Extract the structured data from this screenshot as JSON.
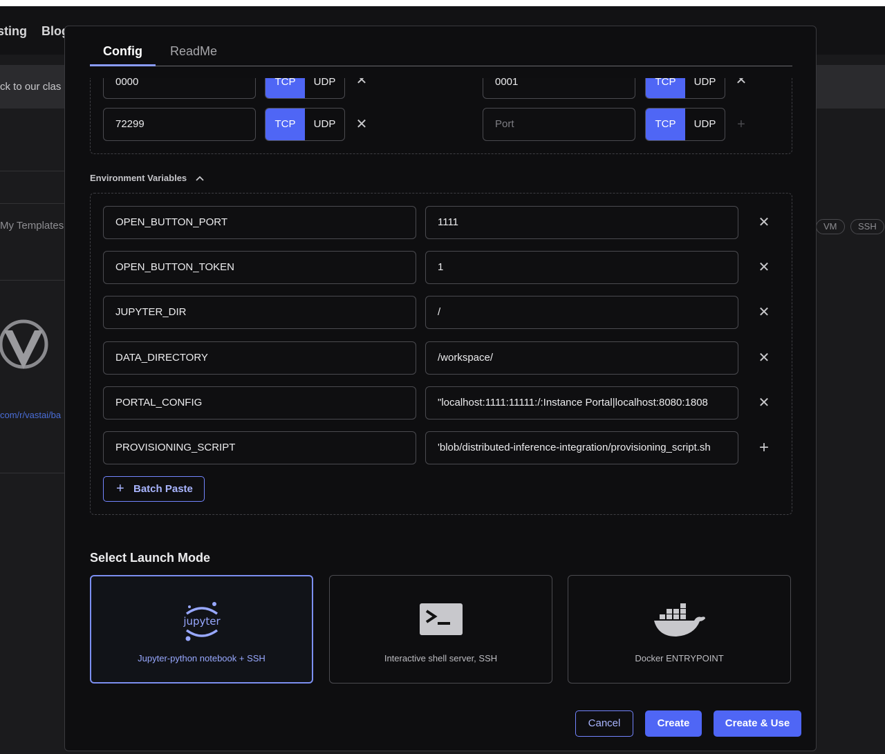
{
  "background": {
    "nav": [
      "sting",
      "Blog"
    ],
    "banner": "ck to our clas",
    "my_templates": "My Templates",
    "link": "com/r/vastai/ba",
    "chips": [
      "VM",
      "SSH"
    ]
  },
  "modal": {
    "tabs": [
      {
        "label": "Config",
        "active": true
      },
      {
        "label": "ReadMe",
        "active": false
      }
    ],
    "ports": {
      "rows": [
        {
          "left_value": "0000",
          "left_proto": [
            "TCP",
            "UDP"
          ],
          "right_value": "0001",
          "right_proto": [
            "TCP",
            "UDP"
          ]
        },
        {
          "left_value": "72299",
          "left_proto": [
            "TCP",
            "UDP"
          ],
          "right_placeholder": "Port",
          "right_proto": [
            "TCP",
            "UDP"
          ]
        }
      ]
    },
    "env": {
      "heading": "Environment Variables",
      "rows": [
        {
          "key": "OPEN_BUTTON_PORT",
          "value": "1111",
          "action": "✕"
        },
        {
          "key": "OPEN_BUTTON_TOKEN",
          "value": "1",
          "action": "✕"
        },
        {
          "key": "JUPYTER_DIR",
          "value": "/",
          "action": "✕"
        },
        {
          "key": "DATA_DIRECTORY",
          "value": "/workspace/",
          "action": "✕"
        },
        {
          "key": "PORTAL_CONFIG",
          "value": "\"localhost:1111:11111:/:Instance Portal|localhost:8080:1808",
          "action": "✕"
        },
        {
          "key": "PROVISIONING_SCRIPT",
          "value": "'blob/distributed-inference-integration/provisioning_script.sh",
          "action": "+"
        }
      ],
      "batch_paste": "Batch Paste"
    },
    "launch": {
      "title": "Select Launch Mode",
      "modes": [
        {
          "label": "Jupyter-python notebook + SSH",
          "icon": "jupyter-icon",
          "icon_text": "jupyter",
          "selected": true
        },
        {
          "label": "Interactive shell server, SSH",
          "icon": "terminal-icon",
          "selected": false
        },
        {
          "label": "Docker ENTRYPOINT",
          "icon": "docker-icon",
          "selected": false
        }
      ]
    },
    "buttons": {
      "cancel": "Cancel",
      "create": "Create",
      "create_use": "Create & Use"
    }
  },
  "colors": {
    "accent": "#4f66f5",
    "accent_light": "#a9b5ff",
    "modal_bg": "#0e0e10"
  }
}
